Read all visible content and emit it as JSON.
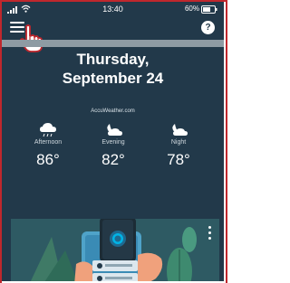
{
  "status_bar": {
    "time": "13:40",
    "battery_percent": "60%"
  },
  "header": {
    "menu_icon": "hamburger-menu-icon",
    "help_label": "?"
  },
  "date": {
    "weekday": "Thursday,",
    "day": "September 24"
  },
  "weather": {
    "source": "AccuWeather.com",
    "forecast": [
      {
        "period": "Afternoon",
        "temp": "86°",
        "icon": "rain-cloud-icon"
      },
      {
        "period": "Evening",
        "temp": "82°",
        "icon": "moon-cloud-icon"
      },
      {
        "period": "Night",
        "temp": "78°",
        "icon": "moon-cloud-icon"
      }
    ]
  },
  "colors": {
    "background": "#22394a",
    "card": "#2e5a63",
    "accent": "#c0272d"
  }
}
